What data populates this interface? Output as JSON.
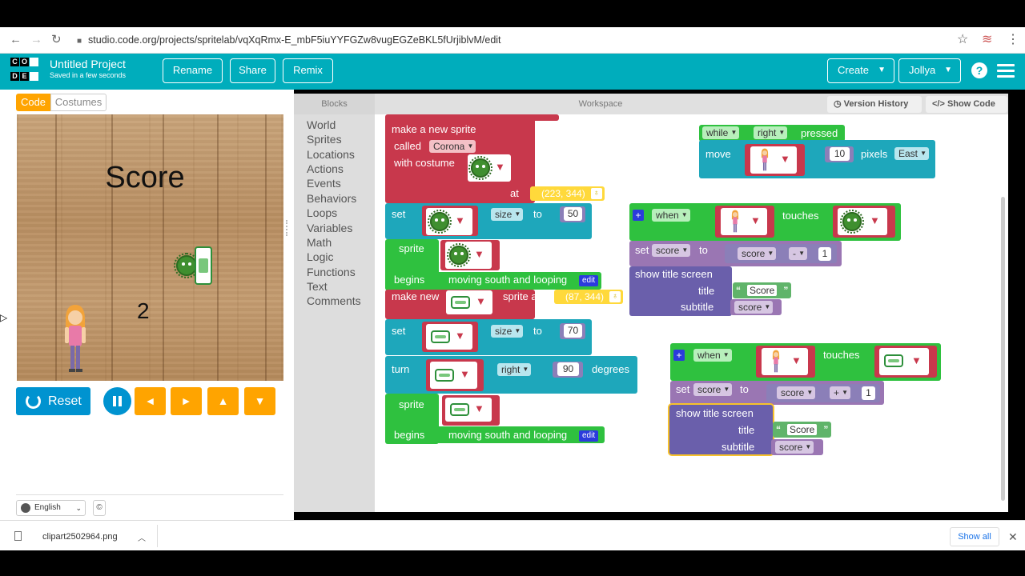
{
  "browser": {
    "url": "studio.code.org/projects/spritelab/vqXqRmx-E_mbF5iuYYFGZw8vugEGZeBKL5fUrjiblvM/edit"
  },
  "header": {
    "logo_letters": [
      "C",
      "O",
      "",
      "D",
      "E",
      ""
    ],
    "project_title": "Untitled Project",
    "saved_status": "Saved in a few seconds",
    "rename": "Rename",
    "share": "Share",
    "remix": "Remix",
    "create": "Create",
    "user": "Jollya",
    "help": "?",
    "brand_color": "#00adbc"
  },
  "left": {
    "tab_code": "Code",
    "tab_costumes": "Costumes",
    "stage_score_label": "Score",
    "stage_score_value": "2",
    "reset": "Reset",
    "arrows": [
      "◄",
      "►",
      "▲",
      "▼"
    ],
    "language": "English",
    "cc": "©"
  },
  "workspace": {
    "blocks_label": "Blocks",
    "workspace_label": "Workspace",
    "version_history": "Version History",
    "show_code": "Show Code",
    "categories": [
      "World",
      "Sprites",
      "Locations",
      "Actions",
      "Events",
      "Behaviors",
      "Loops",
      "Variables",
      "Math",
      "Logic",
      "Functions",
      "Text",
      "Comments"
    ]
  },
  "blocks": {
    "make_new_sprite": "make a new sprite",
    "called": "called",
    "called_value": "Corona",
    "with_costume": "with costume",
    "at": "at",
    "coord1": "(223, 344)",
    "set1": "set",
    "size1": "size",
    "to1": "to",
    "size1_val": "50",
    "sprite1": "sprite",
    "begins1": "begins",
    "behavior1": "moving south and looping",
    "edit": "edit",
    "make_new": "make new",
    "sprite_at": "sprite at",
    "coord2": "(87, 344)",
    "set2": "set",
    "size2": "size",
    "to2": "to",
    "size2_val": "70",
    "turn": "turn",
    "right": "right",
    "turn_val": "90",
    "degrees": "degrees",
    "sprite2": "sprite",
    "begins2": "begins",
    "behavior2": "moving south and looping",
    "while": "while",
    "while_key": "right",
    "pressed": "pressed",
    "move": "move",
    "move_val": "10",
    "pixels": "pixels",
    "dir": "East",
    "when1": "when",
    "touches1": "touches",
    "set_score1": "set",
    "score_var1": "score",
    "to_a": "to",
    "score_op_var1": "score",
    "op1": "-",
    "op1_val": "1",
    "show_title1": "show title screen",
    "title1": "title",
    "title1_str": "Score",
    "subtitle1": "subtitle",
    "subtitle1_var": "score",
    "when2": "when",
    "touches2": "touches",
    "set_score2": "set",
    "score_var2": "score",
    "to_b": "to",
    "score_op_var2": "score",
    "op2": "+",
    "op2_val": "1",
    "show_title2": "show title screen",
    "title2": "title",
    "title2_str": "Score",
    "subtitle2": "subtitle",
    "subtitle2_var": "score",
    "plus": "+",
    "quote_open": "“",
    "quote_close": "”"
  },
  "download": {
    "file": "clipart2502964.png",
    "show_all": "Show all"
  },
  "colors": {
    "sprite_red": "#c8384c",
    "set_teal": "#1ea7bb",
    "event_green": "#2fc13f",
    "variable_purple": "#9a76b3",
    "title_purple": "#6a5fab",
    "location_yellow": "#ffd93b",
    "run_blue": "#0093d0",
    "arrow_orange": "#ffa400"
  }
}
